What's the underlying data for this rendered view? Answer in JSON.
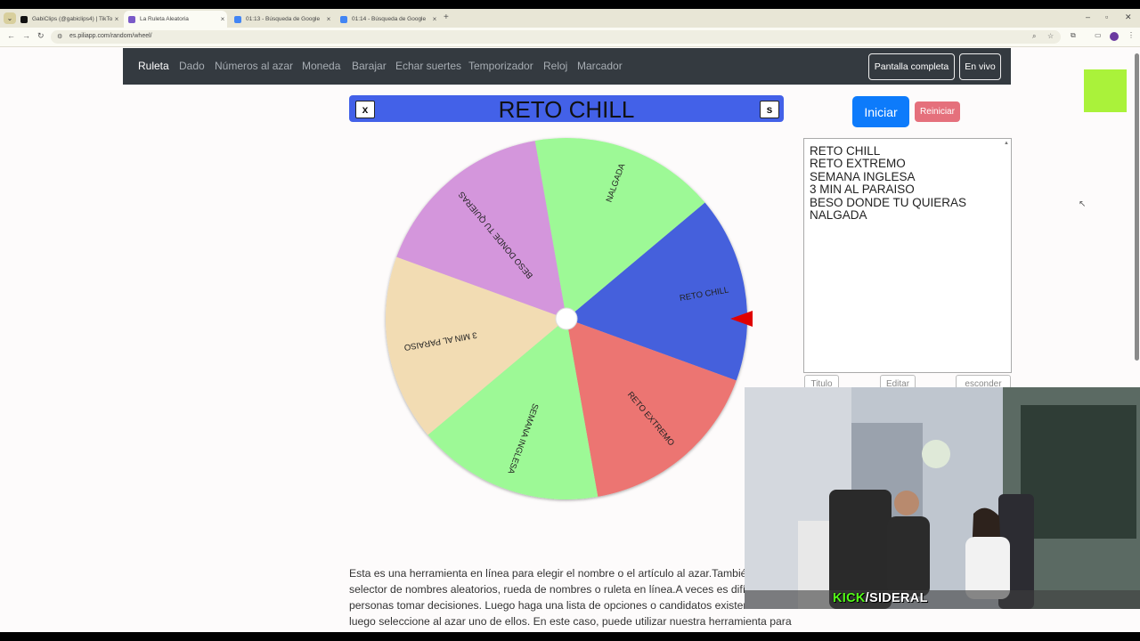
{
  "browser": {
    "tabs": [
      {
        "label": "GabiClips (@gabiclips4) | TikTok",
        "color": "#111111"
      },
      {
        "label": "La Ruleta Aleatoria",
        "color": "#7a5ac8"
      },
      {
        "label": "01:13 - Búsqueda de Google",
        "color": "#4285f4"
      },
      {
        "label": "01:14 - Búsqueda de Google",
        "color": "#4285f4"
      }
    ],
    "url": "es.piliapp.com/random/wheel/"
  },
  "nav": {
    "links": [
      "Ruleta",
      "Dado",
      "Números al azar",
      "Moneda",
      "Barajar",
      "Echar suertes",
      "Temporizador",
      "Reloj",
      "Marcador"
    ],
    "fullscreen": "Pantalla completa",
    "live": "En vivo"
  },
  "wheel": {
    "title": "RETO CHILL",
    "close_label": "x",
    "settings_label": "s",
    "segments": [
      {
        "label": "RETO CHILL",
        "color": "#4460dc"
      },
      {
        "label": "RETO EXTREMO",
        "color": "#ec7472"
      },
      {
        "label": "SEMANA INGLESA",
        "color": "#9df996"
      },
      {
        "label": "3 MIN AL PARAISO",
        "color": "#f2dcb3"
      },
      {
        "label": "BESO DONDE TU QUIERAS",
        "color": "#d496dc"
      },
      {
        "label": "NALGADA",
        "color": "#9df996"
      }
    ],
    "pointer_color": "#e00000"
  },
  "controls": {
    "start": "Iniciar",
    "reset": "Reiniciar",
    "entries": [
      "RETO CHILL",
      "RETO EXTREMO",
      "SEMANA INGLESA",
      "3 MIN AL PARAISO",
      "BESO DONDE TU QUIERAS",
      "NALGADA"
    ],
    "title_btn": "Titulo",
    "edit_btn": "Editar",
    "hide_btn": "esconder"
  },
  "description": [
    "Esta es una herramienta en línea para elegir el nombre o el artículo al azar.También s",
    "selector de nombres aleatorios, rueda de nombres o ruleta en línea.A veces es difícil",
    "personas tomar decisiones. Luego haga una lista de opciones o candidatos existente",
    "luego seleccione al azar uno de ellos. En este caso, puede utilizar nuestra herramienta para"
  ],
  "stream": {
    "brand": "KICK",
    "channel": "/SIDERAL"
  }
}
